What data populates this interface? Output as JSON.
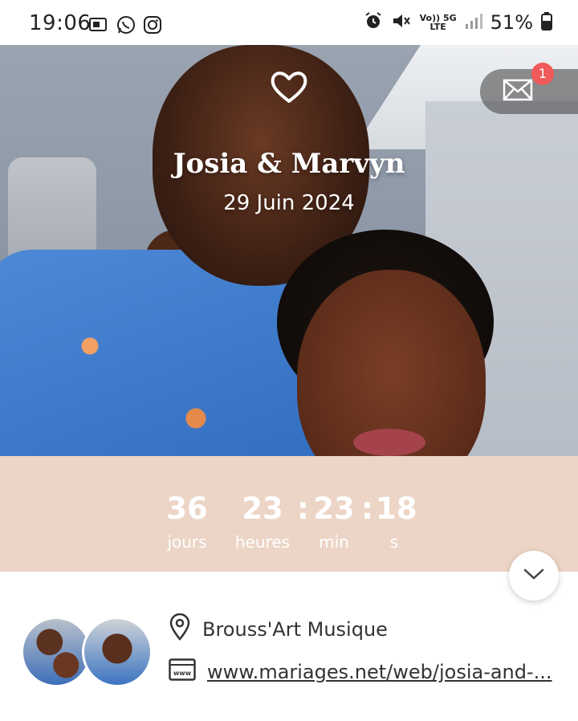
{
  "status_bar": {
    "time": "19:06",
    "battery": "51%",
    "network_top": "Vo)) 5G",
    "network_bottom": "LTE"
  },
  "hero": {
    "couple_names": "Josia & Marvyn",
    "wedding_date": "29 Juin 2024",
    "messages_badge": "1"
  },
  "countdown": {
    "days": "36",
    "days_label": "jours",
    "hours": "23",
    "hours_label": "heures",
    "minutes": "23",
    "minutes_label": "min",
    "seconds": "18",
    "seconds_label": "s"
  },
  "details": {
    "venue": "Brouss'Art Musique",
    "website": "www.mariages.net/web/josia-and-..."
  },
  "colors": {
    "countdown_bg": "#ecd5c6",
    "badge": "#f05a5a"
  },
  "icons": [
    "heart-icon",
    "mail-icon",
    "chevron-down-icon",
    "location-pin-icon",
    "web-icon",
    "alarm-icon",
    "mute-icon",
    "signal-icon",
    "battery-icon",
    "whatsapp-icon",
    "instagram-icon"
  ]
}
